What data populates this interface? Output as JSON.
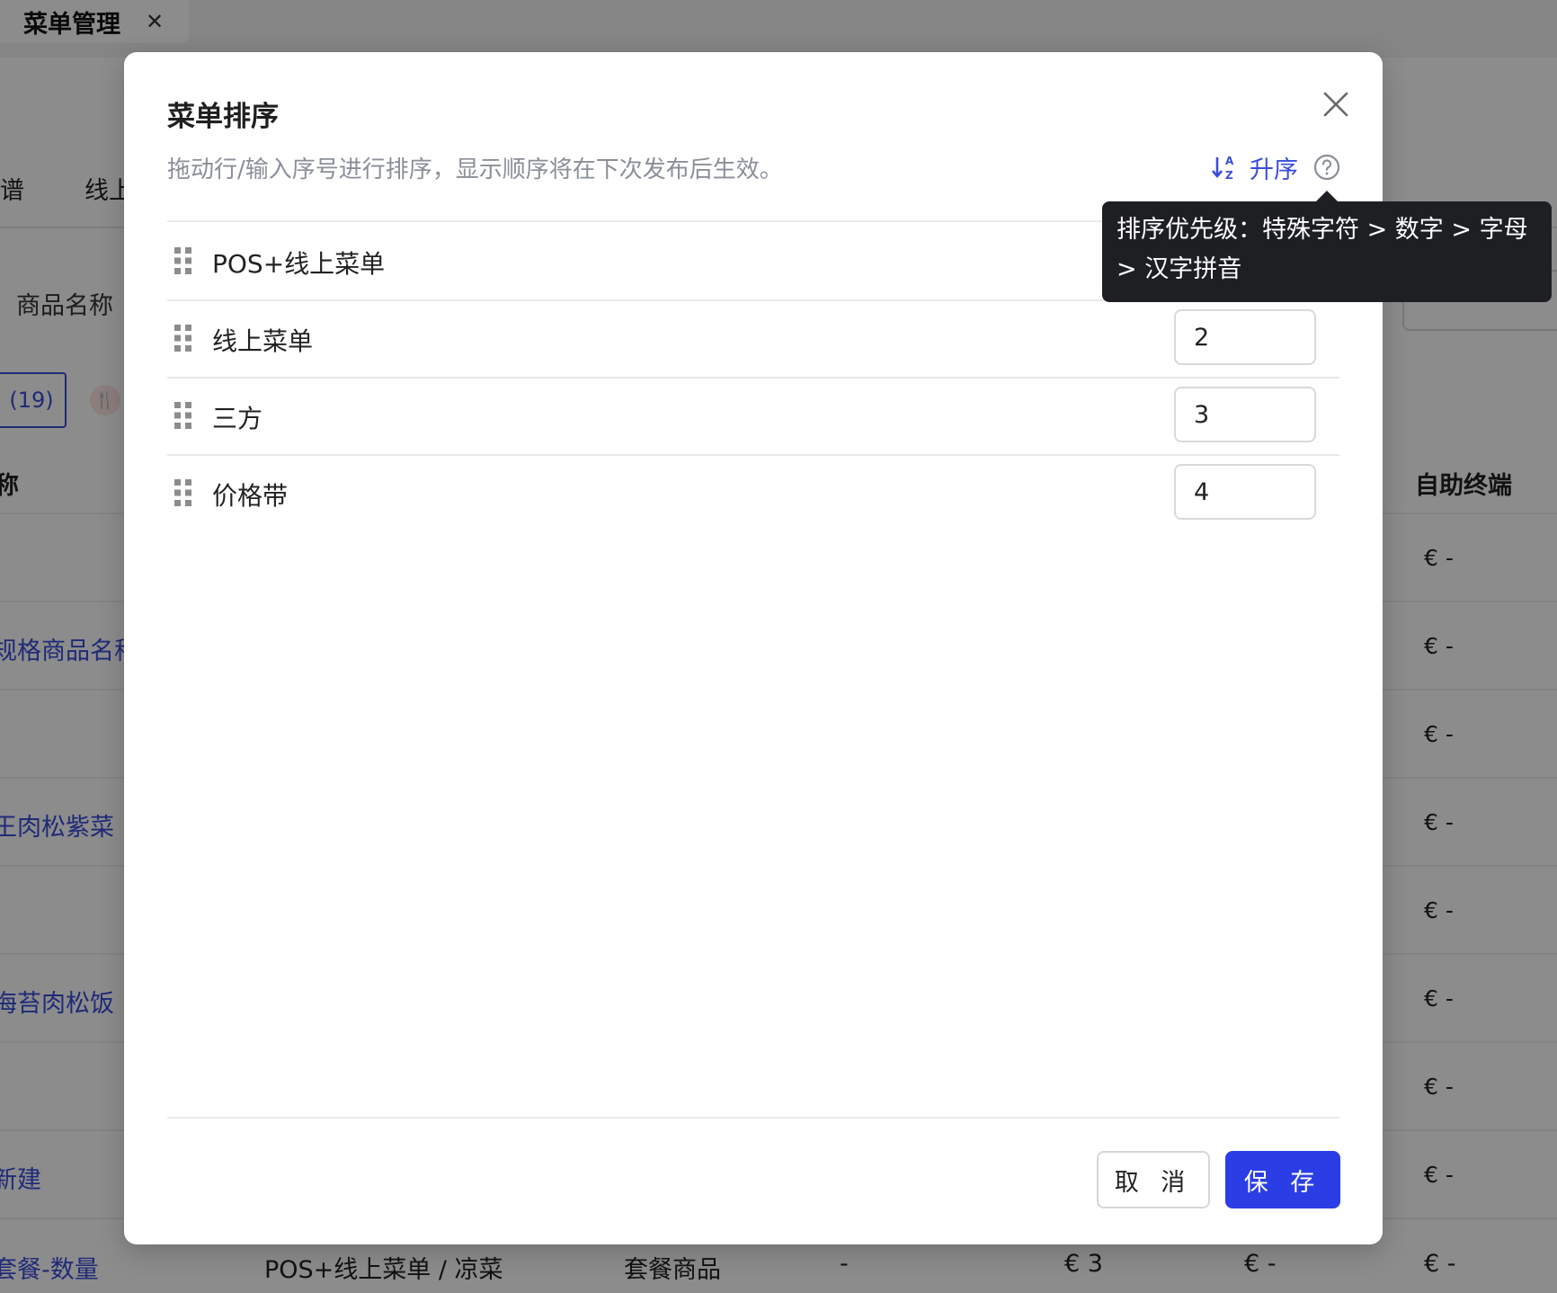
{
  "background": {
    "top_tab": {
      "title": "菜单管理",
      "close_icon": "close-icon"
    },
    "nav_fragments": [
      "谱",
      "线上"
    ],
    "filter_label": "商品名称",
    "count_chip": "(19)",
    "column_head_left": "称",
    "column_head_right": "自助终端",
    "row_links": [
      "规格商品名称",
      "王肉松紫菜",
      "海苔肉松饭",
      "新建",
      "套餐-数量"
    ],
    "euro_cells": [
      "€ -",
      "€ -",
      "€ -",
      "€ -",
      "€ -",
      "€ -",
      "€ -",
      "€ -",
      "€ -"
    ],
    "last_row": {
      "category": "POS+线上菜单 / 凉菜",
      "type": "套餐商品",
      "dash": "-",
      "price1": "€ 3",
      "price2": "€ -",
      "price3": "€ -"
    }
  },
  "modal": {
    "title": "菜单排序",
    "description": "拖动行/输入序号进行排序，显示顺序将在下次发布后生效。",
    "sort_label": "升序",
    "tooltip": "排序优先级：特殊字符 > 数字 > 字母 > 汉字拼音",
    "rows": [
      {
        "name": "POS+线上菜单",
        "order": "1"
      },
      {
        "name": "线上菜单",
        "order": "2"
      },
      {
        "name": "三方",
        "order": "3"
      },
      {
        "name": "价格带",
        "order": "4"
      }
    ],
    "cancel_label": "取 消",
    "save_label": "保 存"
  },
  "colors": {
    "primary": "#2b3ee6",
    "link": "#3a4ddb",
    "tooltip_bg": "#1d1f23",
    "overlay": "rgba(0,0,0,0.45)"
  }
}
